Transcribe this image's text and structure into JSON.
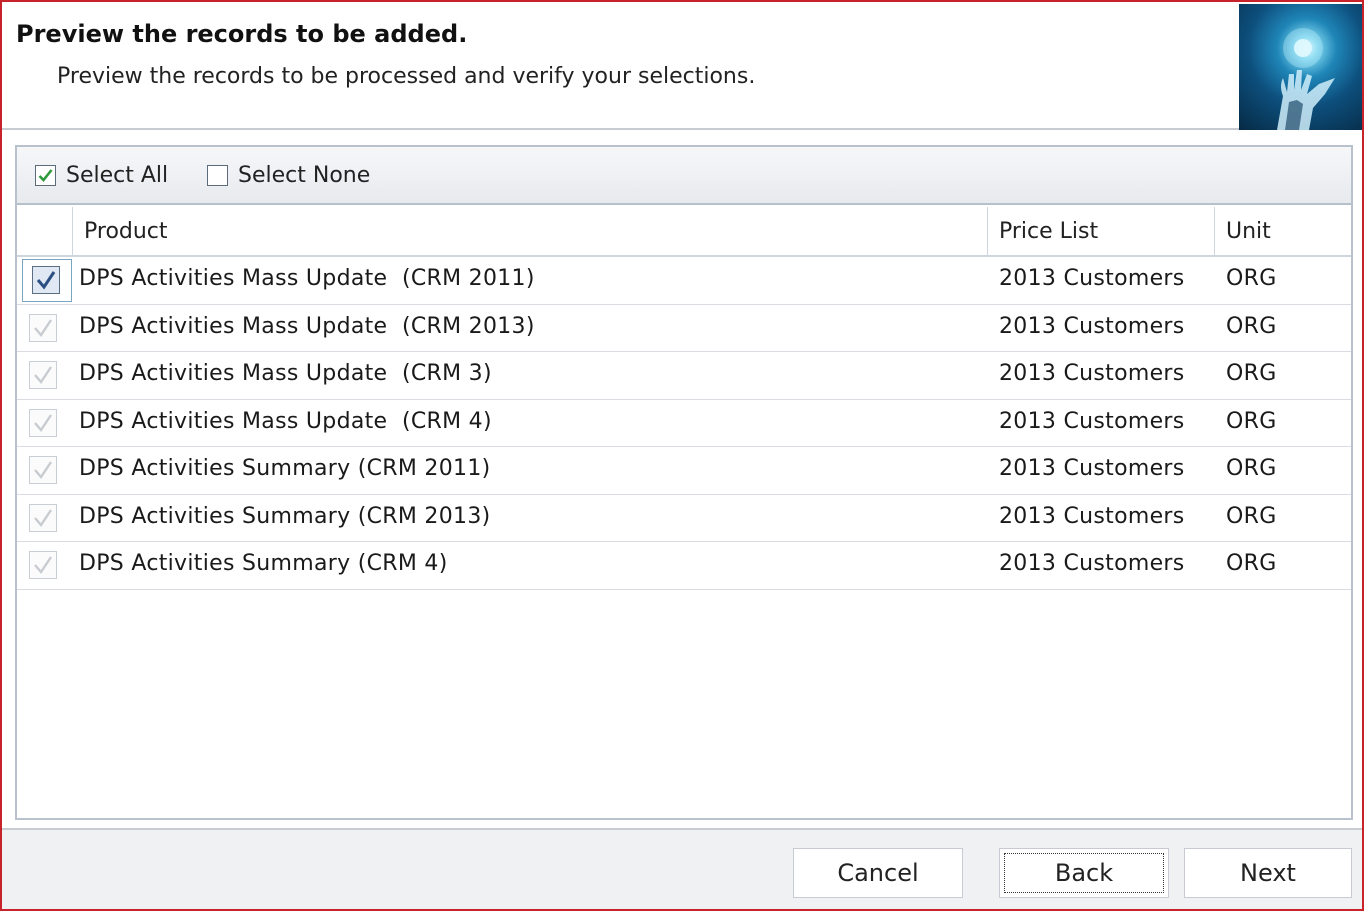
{
  "header": {
    "title": "Preview the records to be added.",
    "subtitle": "Preview the records to be processed and verify your selections."
  },
  "selection": {
    "select_all_label": "Select All",
    "select_all_checked": true,
    "select_none_label": "Select None",
    "select_none_checked": false
  },
  "grid": {
    "columns": [
      "Product",
      "Price List",
      "Unit"
    ],
    "rows": [
      {
        "product": "DPS Activities Mass Update  (CRM 2011)",
        "price_list": "2013 Customers",
        "unit": "ORG",
        "checked": true
      },
      {
        "product": "DPS Activities Mass Update  (CRM 2013)",
        "price_list": "2013 Customers",
        "unit": "ORG",
        "checked": true
      },
      {
        "product": "DPS Activities Mass Update  (CRM 3)",
        "price_list": "2013 Customers",
        "unit": "ORG",
        "checked": true
      },
      {
        "product": "DPS Activities Mass Update  (CRM 4)",
        "price_list": "2013 Customers",
        "unit": "ORG",
        "checked": true
      },
      {
        "product": "DPS Activities Summary (CRM 2011)",
        "price_list": "2013 Customers",
        "unit": "ORG",
        "checked": true
      },
      {
        "product": "DPS Activities Summary (CRM 2013)",
        "price_list": "2013 Customers",
        "unit": "ORG",
        "checked": true
      },
      {
        "product": "DPS Activities Summary (CRM 4)",
        "price_list": "2013 Customers",
        "unit": "ORG",
        "checked": true
      }
    ]
  },
  "footer": {
    "cancel_label": "Cancel",
    "back_label": "Back",
    "next_label": "Next"
  },
  "colors": {
    "window_border": "#c8222a",
    "check_green": "#2e9a3c",
    "check_blue": "#2b4f82",
    "check_disabled": "#c8ccd0"
  },
  "icons": {
    "header_image": "hand-light-image",
    "select_all": "checkbox-checked-icon",
    "select_none": "checkbox-empty-icon"
  }
}
